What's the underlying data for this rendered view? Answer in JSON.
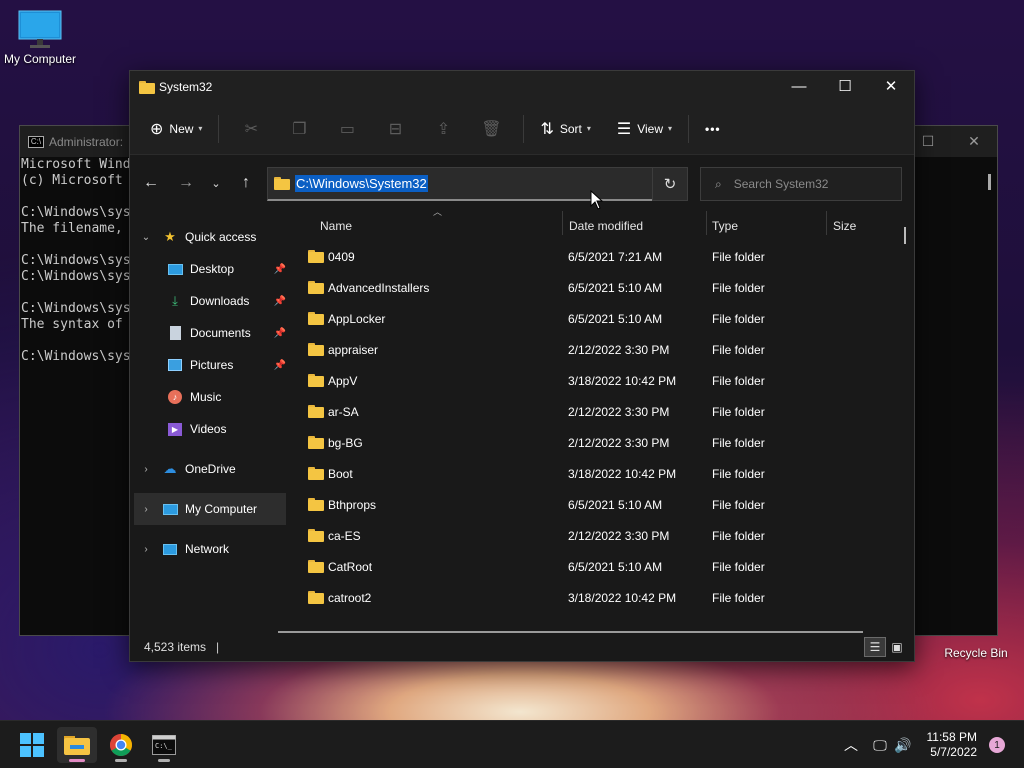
{
  "desktop": {
    "icons": [
      {
        "label": "My Computer"
      },
      {
        "label": "Recycle Bin"
      }
    ]
  },
  "console": {
    "title": "Administrator: ",
    "lines": [
      "Microsoft Wind",
      "(c) Microsoft",
      "",
      "C:\\Windows\\sys",
      "The filename,",
      "",
      "C:\\Windows\\sys",
      "C:\\Windows\\sys",
      "",
      "C:\\Windows\\sys",
      "The syntax of",
      "",
      "C:\\Windows\\sys"
    ]
  },
  "explorer": {
    "title": "System32",
    "toolbar": {
      "new_label": "New",
      "sort_label": "Sort",
      "view_label": "View",
      "more_label": "•••"
    },
    "address": "C:\\Windows\\System32",
    "search_placeholder": "Search System32",
    "sidebar": {
      "quick_access": "Quick access",
      "items": [
        {
          "label": "Desktop"
        },
        {
          "label": "Downloads"
        },
        {
          "label": "Documents"
        },
        {
          "label": "Pictures"
        },
        {
          "label": "Music"
        },
        {
          "label": "Videos"
        }
      ],
      "onedrive": "OneDrive",
      "my_computer": "My Computer",
      "network": "Network"
    },
    "columns": {
      "name": "Name",
      "date": "Date modified",
      "type": "Type",
      "size": "Size"
    },
    "rows": [
      {
        "name": "0409",
        "date": "6/5/2021 7:21 AM",
        "type": "File folder"
      },
      {
        "name": "AdvancedInstallers",
        "date": "6/5/2021 5:10 AM",
        "type": "File folder"
      },
      {
        "name": "AppLocker",
        "date": "6/5/2021 5:10 AM",
        "type": "File folder"
      },
      {
        "name": "appraiser",
        "date": "2/12/2022 3:30 PM",
        "type": "File folder"
      },
      {
        "name": "AppV",
        "date": "3/18/2022 10:42 PM",
        "type": "File folder"
      },
      {
        "name": "ar-SA",
        "date": "2/12/2022 3:30 PM",
        "type": "File folder"
      },
      {
        "name": "bg-BG",
        "date": "2/12/2022 3:30 PM",
        "type": "File folder"
      },
      {
        "name": "Boot",
        "date": "3/18/2022 10:42 PM",
        "type": "File folder"
      },
      {
        "name": "Bthprops",
        "date": "6/5/2021 5:10 AM",
        "type": "File folder"
      },
      {
        "name": "ca-ES",
        "date": "2/12/2022 3:30 PM",
        "type": "File folder"
      },
      {
        "name": "CatRoot",
        "date": "6/5/2021 5:10 AM",
        "type": "File folder"
      },
      {
        "name": "catroot2",
        "date": "3/18/2022 10:42 PM",
        "type": "File folder"
      }
    ],
    "status": {
      "item_count": "4,523 items"
    }
  },
  "taskbar": {
    "time": "11:58 PM",
    "date": "5/7/2022",
    "notification_count": "1"
  }
}
